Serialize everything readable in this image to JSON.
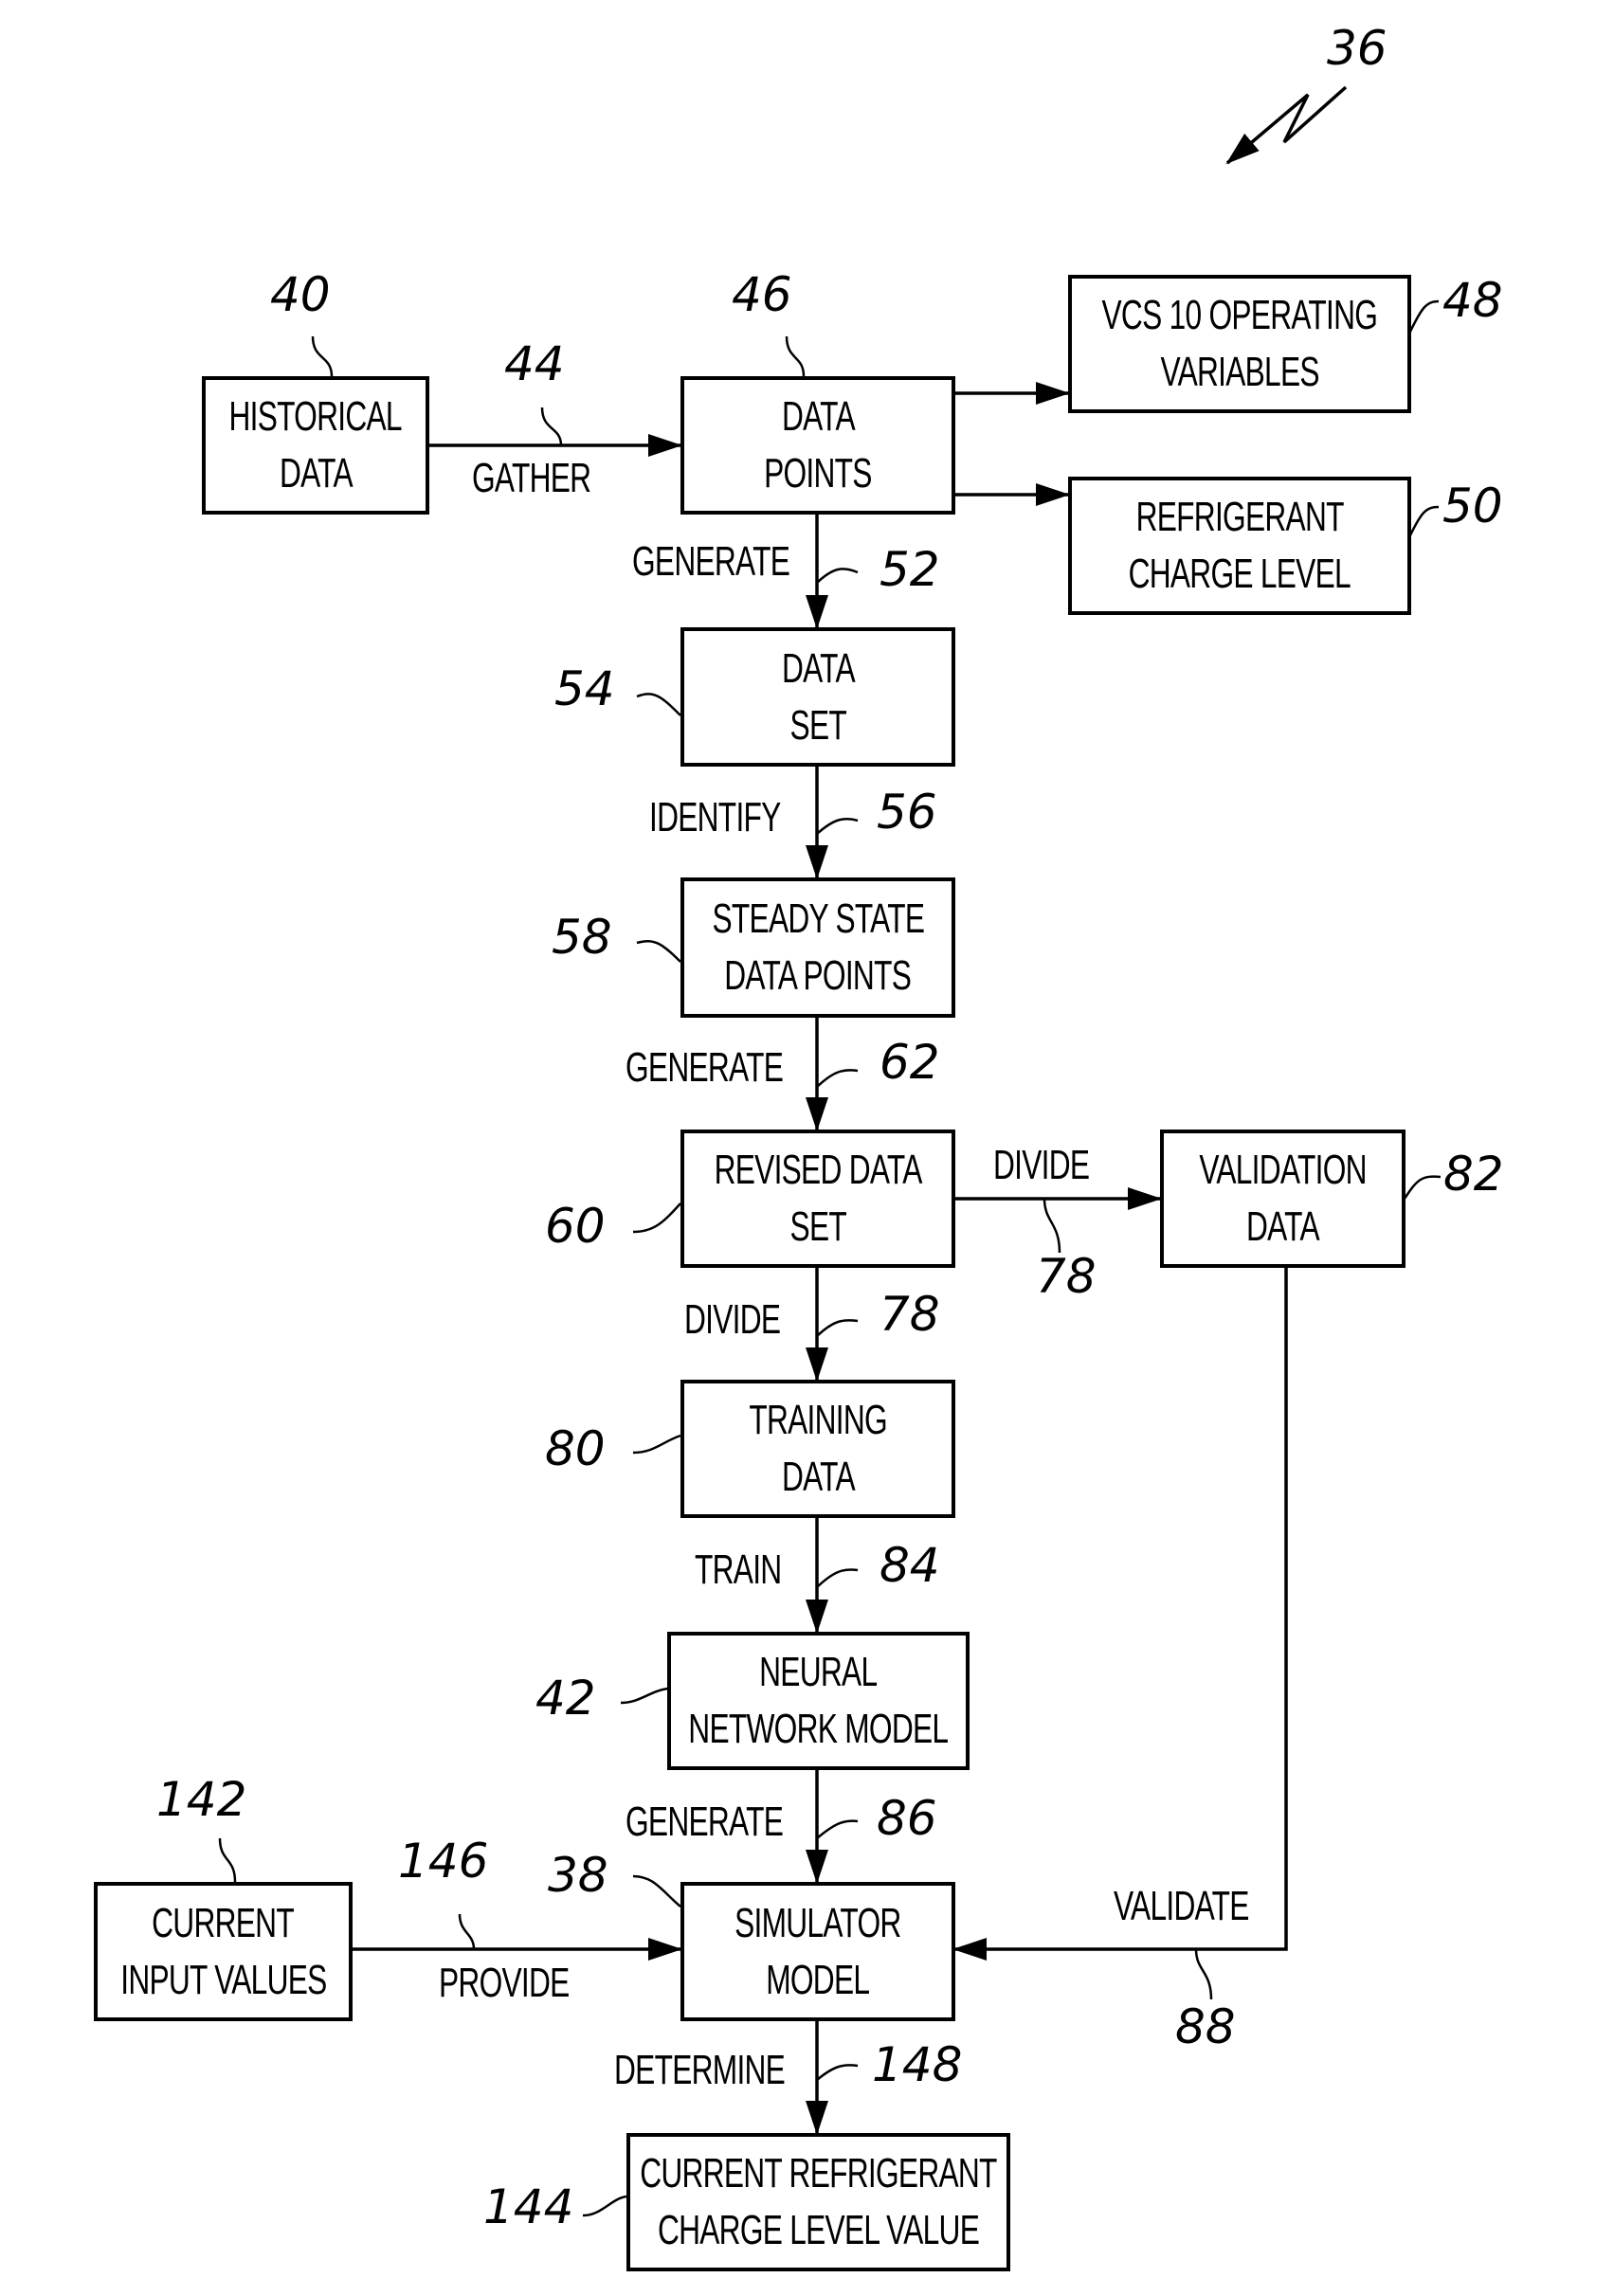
{
  "figure_ref": "36",
  "boxes": {
    "historical": {
      "ref": "40",
      "lines": [
        "HISTORICAL",
        "DATA"
      ]
    },
    "data_points": {
      "ref": "46",
      "lines": [
        "DATA",
        "POINTS"
      ]
    },
    "vcs": {
      "ref": "48",
      "lines": [
        "VCS 10 OPERATING",
        "VARIABLES"
      ]
    },
    "refrigerant": {
      "ref": "50",
      "lines": [
        "REFRIGERANT",
        "CHARGE LEVEL"
      ]
    },
    "data_set": {
      "ref": "54",
      "lines": [
        "DATA",
        "SET"
      ]
    },
    "steady": {
      "ref": "58",
      "lines": [
        "STEADY STATE",
        "DATA POINTS"
      ]
    },
    "revised": {
      "ref": "60",
      "lines": [
        "REVISED DATA",
        "SET"
      ]
    },
    "validation": {
      "ref": "82",
      "lines": [
        "VALIDATION",
        "DATA"
      ]
    },
    "training": {
      "ref": "80",
      "lines": [
        "TRAINING",
        "DATA"
      ]
    },
    "neural": {
      "ref": "42",
      "lines": [
        "NEURAL",
        "NETWORK MODEL"
      ]
    },
    "current_input": {
      "ref": "142",
      "lines": [
        "CURRENT",
        "INPUT VALUES"
      ]
    },
    "simulator": {
      "ref": "38",
      "lines": [
        "SIMULATOR",
        "MODEL"
      ]
    },
    "current_charge": {
      "ref": "144",
      "lines": [
        "CURRENT REFRIGERANT",
        "CHARGE LEVEL VALUE"
      ]
    }
  },
  "steps": {
    "gather": {
      "ref": "44",
      "label": "GATHER"
    },
    "generate1": {
      "ref": "52",
      "label": "GENERATE"
    },
    "identify": {
      "ref": "56",
      "label": "IDENTIFY"
    },
    "generate2": {
      "ref": "62",
      "label": "GENERATE"
    },
    "divide_right": {
      "ref": "78",
      "label": "DIVIDE"
    },
    "divide_down": {
      "ref": "78",
      "label": "DIVIDE"
    },
    "train": {
      "ref": "84",
      "label": "TRAIN"
    },
    "generate3": {
      "ref": "86",
      "label": "GENERATE"
    },
    "provide": {
      "ref": "146",
      "label": "PROVIDE"
    },
    "validate": {
      "ref": "88",
      "label": "VALIDATE"
    },
    "determine": {
      "ref": "148",
      "label": "DETERMINE"
    }
  }
}
